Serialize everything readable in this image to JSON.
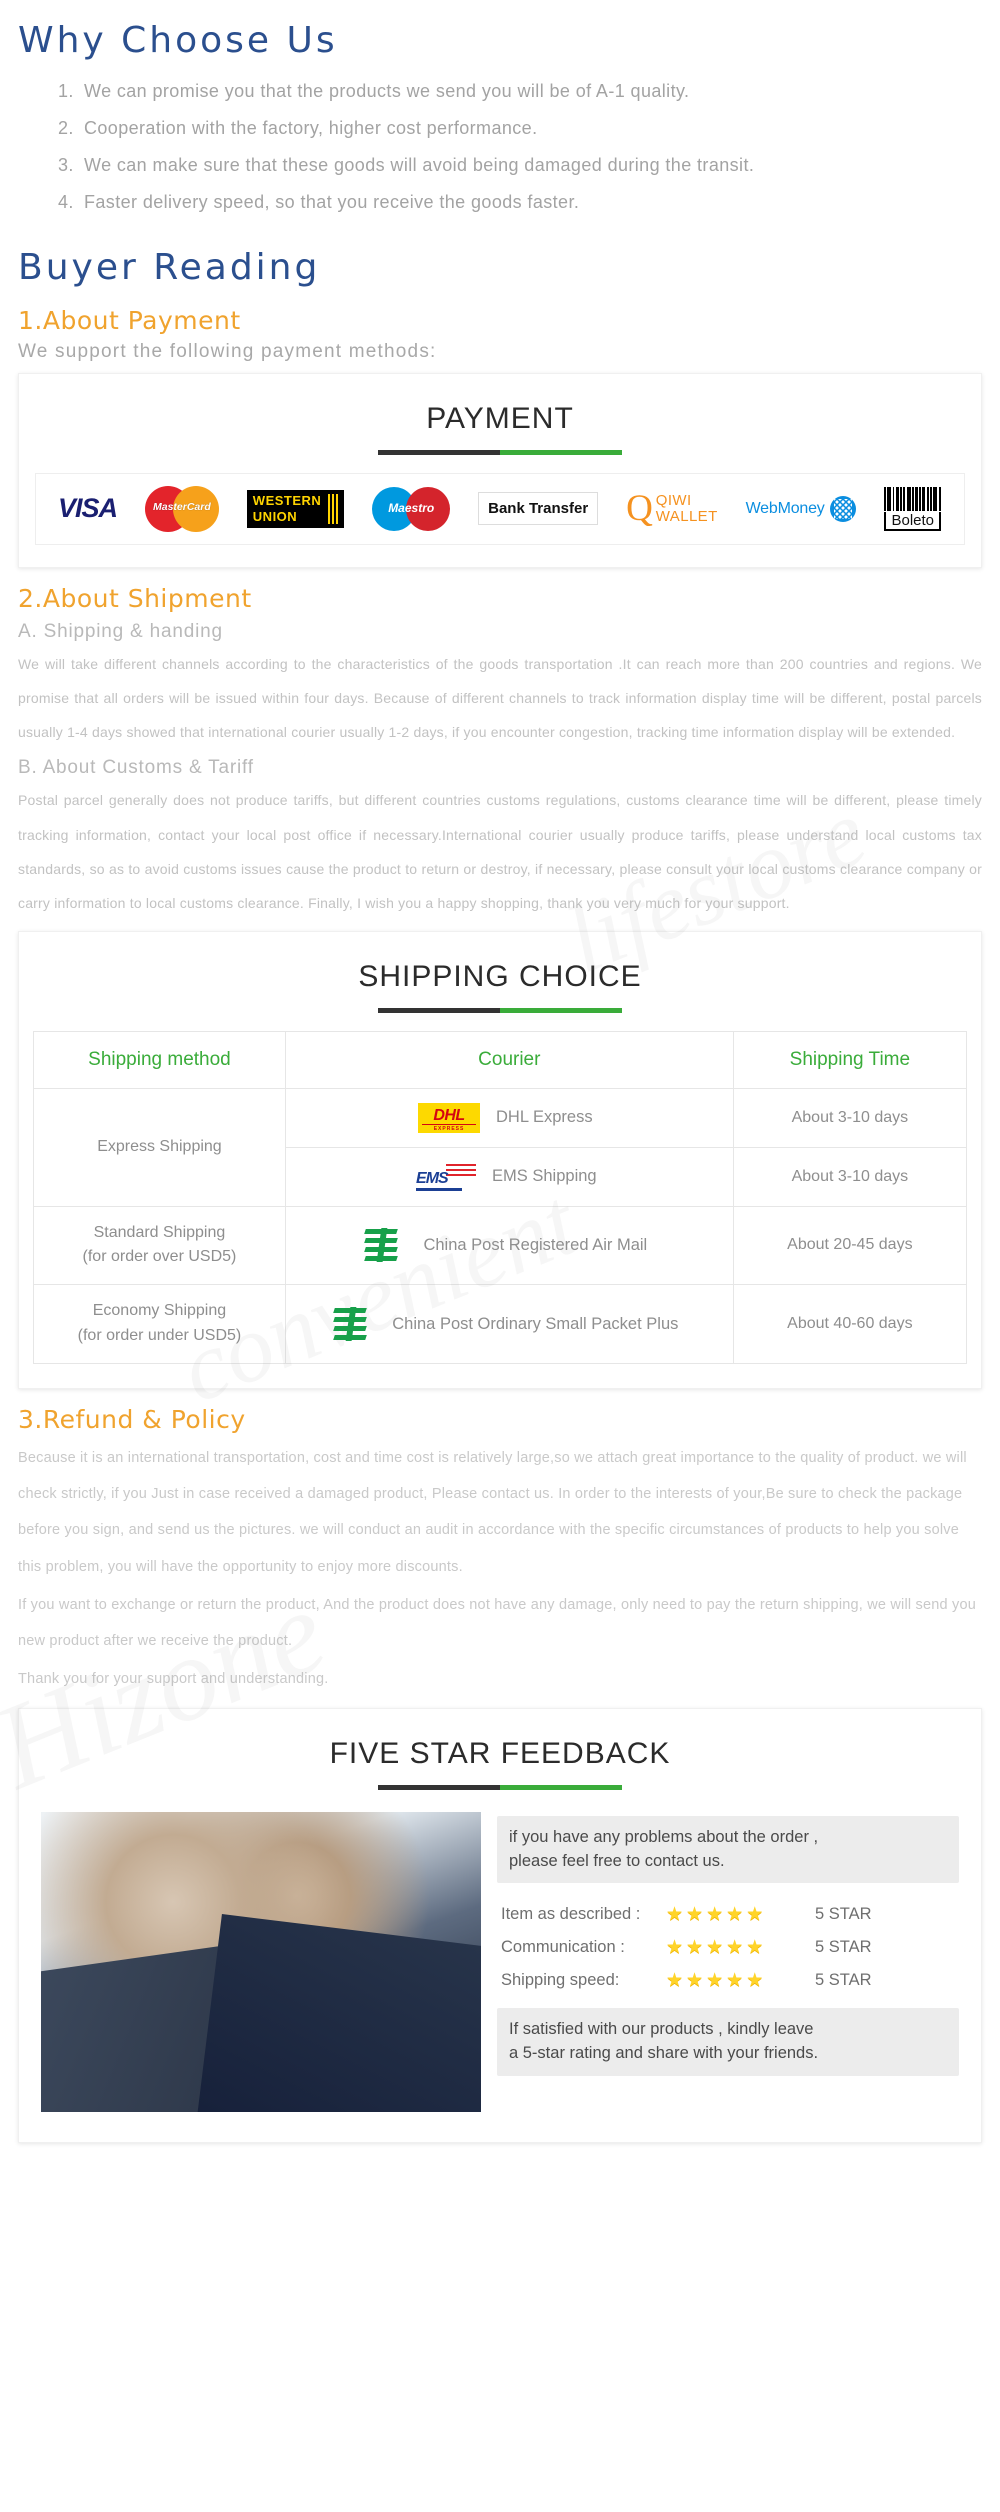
{
  "why_choose": {
    "title": "Why Choose Us",
    "items": [
      {
        "idx": "1.",
        "text": "We  can  promise  you  that  the  products  we  send  you  will  be  of  A-1  quality."
      },
      {
        "idx": "2.",
        "text": "Cooperation  with  the  factory,  higher  cost  performance."
      },
      {
        "idx": "3.",
        "text": "We  can  make  sure  that  these  goods  will  avoid  being  damaged  during  the  transit."
      },
      {
        "idx": "4.",
        "text": "Faster  delivery  speed,  so  that  you  receive  the  goods  faster."
      }
    ]
  },
  "buyer_reading": {
    "title": "Buyer  Reading"
  },
  "payment": {
    "heading": "1.About Payment",
    "lead": "We  support  the  following  payment  methods:",
    "panel_title": "PAYMENT",
    "methods": [
      {
        "name": "visa-logo",
        "label": "VISA"
      },
      {
        "name": "mastercard-logo",
        "label": "MasterCard"
      },
      {
        "name": "western-union-logo",
        "label_line1": "WESTERN",
        "label_line2": "UNION"
      },
      {
        "name": "maestro-logo",
        "label": "Maestro"
      },
      {
        "name": "bank-transfer-logo",
        "label": "Bank Transfer"
      },
      {
        "name": "qiwi-wallet-logo",
        "q": "Q",
        "label_line1": "QIWI",
        "label_line2": "WALLET"
      },
      {
        "name": "webmoney-logo",
        "label": "WebMoney"
      },
      {
        "name": "boleto-logo",
        "label": "Boleto"
      }
    ]
  },
  "shipment": {
    "heading": "2.About Shipment",
    "sub_a": "A.  Shipping  &  handing",
    "para_a": "We will take different channels according to the characteristics of the goods transportation .It can reach more than 200 countries and regions. We promise that all orders will be issued within four days. Because of different channels to track information display time will be different, postal parcels usually 1-4 days showed that international courier usually 1-2 days, if you encounter congestion, tracking time information display will be extended.",
    "sub_b": "B.  About  Customs  &  Tariff",
    "para_b": "Postal parcel generally does not produce tariffs, but different countries customs regulations, customs clearance time will be different, please timely tracking information, contact your local post office if necessary.International courier usually produce tariffs, please understand local customs tax standards, so as to avoid customs issues cause the product to return or destroy, if necessary, please consult your local customs clearance company or carry information to local customs clearance. Finally, I wish you a happy shopping, thank you very much for your support."
  },
  "shipping_table": {
    "panel_title": "SHIPPING CHOICE",
    "headers": [
      "Shipping method",
      "Courier",
      "Shipping Time"
    ],
    "rows": [
      {
        "method": "Express Shipping",
        "method_sub": "",
        "couriers": [
          {
            "icon": "dhl-logo",
            "label": "DHL Express",
            "time": "About 3-10 days"
          },
          {
            "icon": "ems-logo",
            "label": "EMS Shipping",
            "time": "About 3-10 days"
          }
        ]
      },
      {
        "method": "Standard Shipping",
        "method_sub": "(for order over USD5)",
        "couriers": [
          {
            "icon": "china-post-logo",
            "label": "China Post Registered Air Mail",
            "time": "About 20-45 days"
          }
        ]
      },
      {
        "method": "Economy Shipping",
        "method_sub": "(for order under USD5)",
        "couriers": [
          {
            "icon": "china-post-logo",
            "label": "China Post Ordinary Small Packet Plus",
            "time": "About 40-60 days"
          }
        ]
      }
    ]
  },
  "refund": {
    "heading": "3.Refund & Policy",
    "paragraphs": [
      "Because it is an international transportation, cost and time cost is relatively large,so we attach great importance to the quality of product. we will check strictly, if you Just in case received a damaged product, Please contact us. In order to the interests of your,Be sure to check the package before you sign, and send us the pictures. we will conduct an audit in accordance with the specific circumstances of products to help you solve this problem, you will have the opportunity to enjoy more discounts.",
      "If you want to exchange or return the product, And the product does not have any damage, only need to pay the return shipping, we will send you new product after we receive the product.",
      "Thank you for your support and understanding."
    ]
  },
  "feedback": {
    "panel_title": "FIVE STAR FEEDBACK",
    "photo_alt": "two-businessmen-photo",
    "note_top": "if you have any problems about the order ,\nplease feel free to contact us.",
    "rows": [
      {
        "label": "Item as described :",
        "stars": 5,
        "value": "5 STAR"
      },
      {
        "label": "Communication :",
        "stars": 5,
        "value": "5 STAR"
      },
      {
        "label": "Shipping speed:",
        "stars": 5,
        "value": "5 STAR"
      }
    ],
    "note_bottom": "If satisfied with our products ,  kindly leave\na 5-star rating and share with your friends."
  },
  "watermarks": {
    "w1": "lifestore",
    "w2": "convenient",
    "w3": "Hizone"
  },
  "colors": {
    "heading_blue": "#2b4f8e",
    "heading_orange": "#f0a32e",
    "accent_green": "#3aac3a",
    "rule_dark": "#333333",
    "body_gray": "#c2c2c2",
    "star_yellow": "#ffd42a"
  }
}
